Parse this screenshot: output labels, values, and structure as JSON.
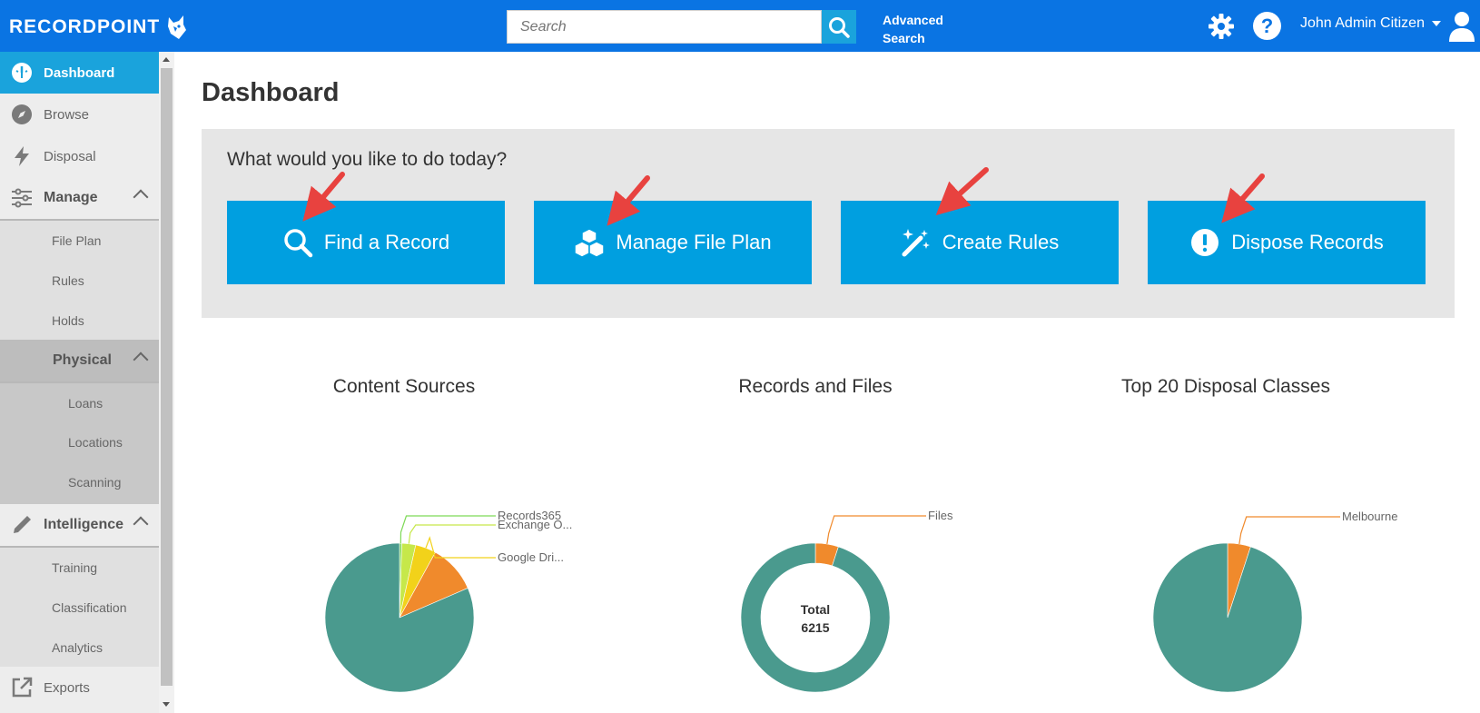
{
  "app": {
    "brand": "RECORDPOINT",
    "search_placeholder": "Search",
    "advanced_search": "Advanced Search",
    "user_name": "John Admin Citizen",
    "accent_color": "#0a74e3",
    "button_color": "#009fe0",
    "active_nav_color": "#1aa3dc"
  },
  "sidebar": {
    "dashboard": "Dashboard",
    "browse": "Browse",
    "disposal": "Disposal",
    "manage": "Manage",
    "manage_items": [
      "File Plan",
      "Rules",
      "Holds"
    ],
    "physical": "Physical",
    "physical_items": [
      "Loans",
      "Locations",
      "Scanning"
    ],
    "intelligence": "Intelligence",
    "intelligence_items": [
      "Training",
      "Classification",
      "Analytics"
    ],
    "exports": "Exports"
  },
  "main": {
    "title": "Dashboard",
    "question": "What would you like to do today?",
    "actions": [
      {
        "label": "Find a Record",
        "icon": "search-icon"
      },
      {
        "label": "Manage File Plan",
        "icon": "cubes-icon"
      },
      {
        "label": "Create Rules",
        "icon": "magic-wand-icon"
      },
      {
        "label": "Dispose Records",
        "icon": "exclamation-icon"
      }
    ]
  },
  "chart_data": [
    {
      "type": "pie",
      "title": "Content Sources",
      "slices": [
        {
          "label": "Records365",
          "value": 0.5,
          "color": "#7ed957"
        },
        {
          "label": "Exchange O...",
          "value": 3,
          "color": "#c6e84a"
        },
        {
          "label": "Google Dri...",
          "value": 4.5,
          "color": "#f2d21a"
        },
        {
          "label": "",
          "value": 10.5,
          "color": "#f08a2c"
        },
        {
          "label": "",
          "value": 81.5,
          "color": "#4a9a8e"
        }
      ]
    },
    {
      "type": "donut",
      "title": "Records and Files",
      "center_label": "Total",
      "center_value": "6215",
      "slices": [
        {
          "label": "Files",
          "value": 5,
          "color": "#f08a2c"
        },
        {
          "label": "",
          "value": 95,
          "color": "#4a9a8e"
        }
      ]
    },
    {
      "type": "pie",
      "title": "Top 20 Disposal Classes",
      "slices": [
        {
          "label": "Melbourne",
          "value": 5,
          "color": "#f08a2c"
        },
        {
          "label": "",
          "value": 95,
          "color": "#4a9a8e"
        }
      ]
    }
  ]
}
